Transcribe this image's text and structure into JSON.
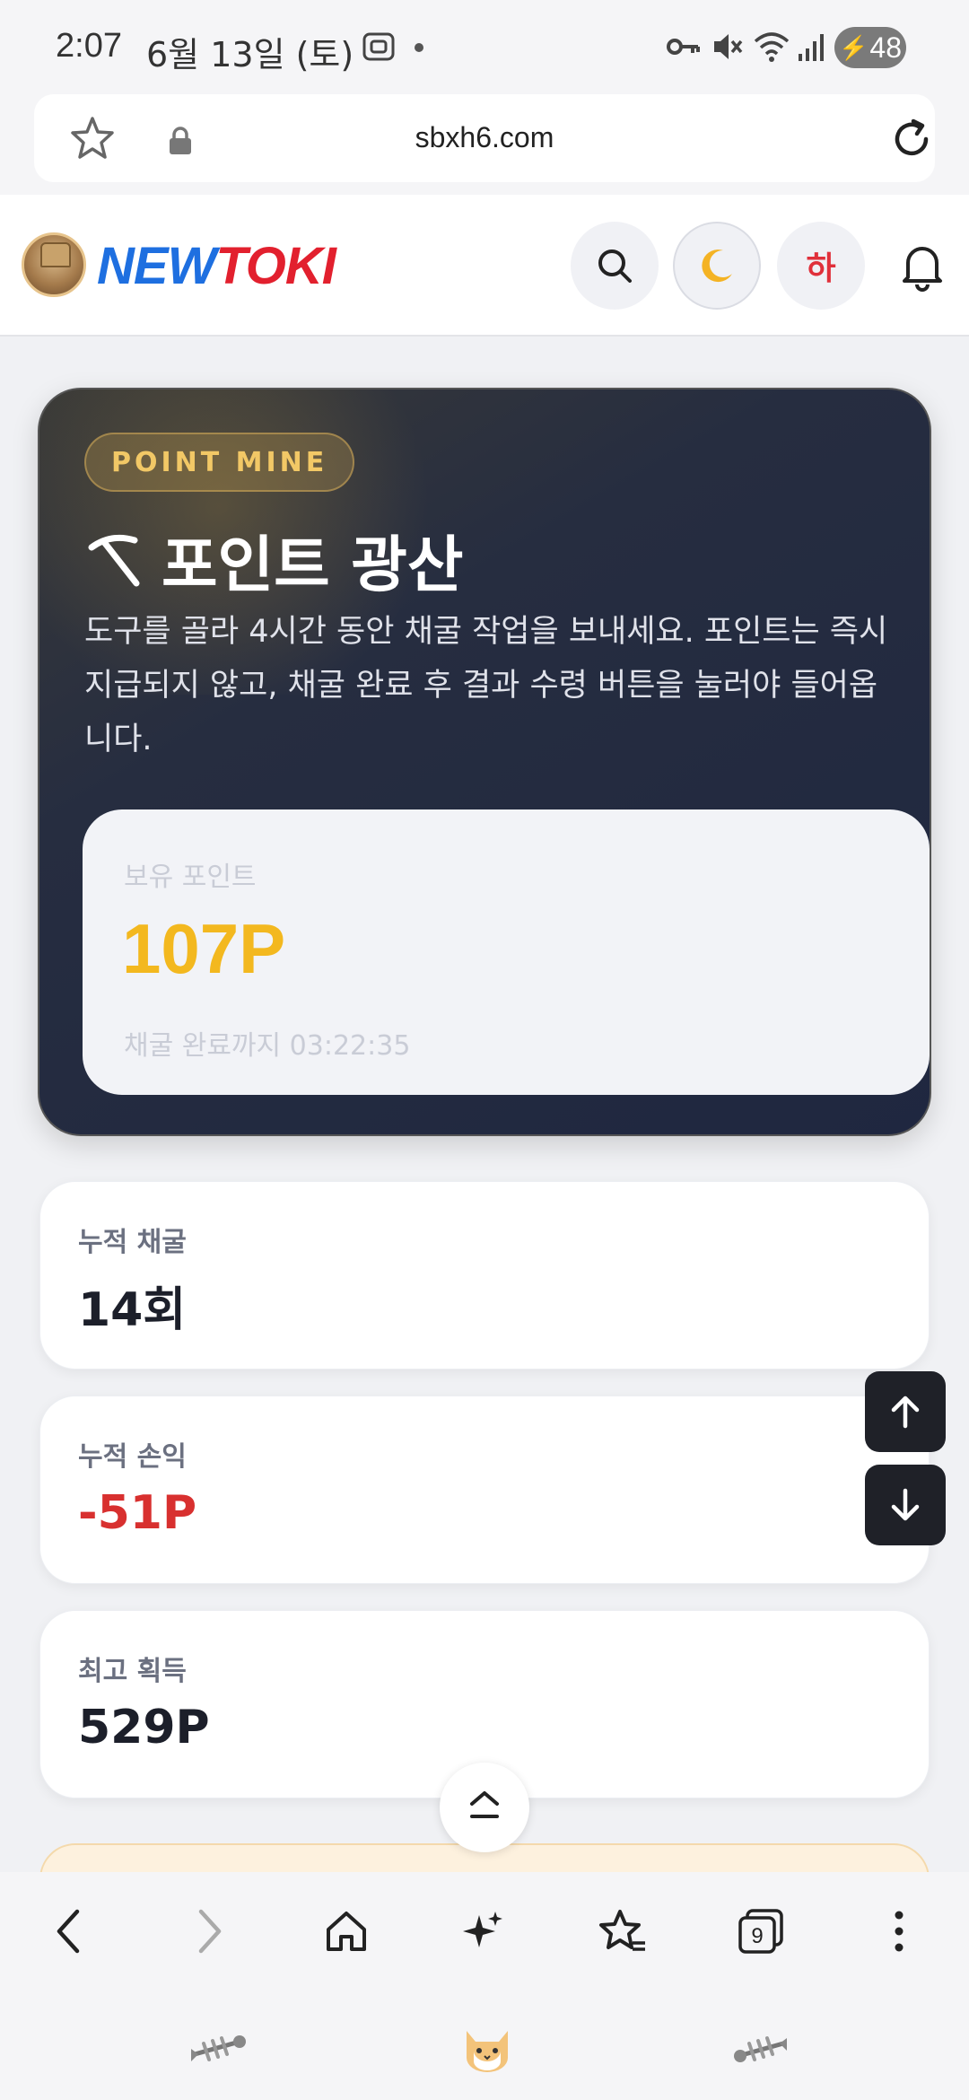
{
  "status_bar": {
    "time": "2:07",
    "date": "6월 13일 (토)",
    "battery": "48",
    "icons": [
      "screenshot-icon",
      "key-icon",
      "mute-icon",
      "wifi-icon",
      "signal-icon",
      "battery-icon"
    ]
  },
  "browser": {
    "url": "sbxh6.com",
    "icons": [
      "star-icon",
      "lock-icon",
      "reload-icon"
    ]
  },
  "header": {
    "logo_part1": "NEW",
    "logo_part2": "TOKI",
    "lang_label": "하",
    "icons": [
      "search-icon",
      "moon-icon",
      "bell-icon"
    ]
  },
  "hero": {
    "badge": "POINT MINE",
    "title": "포인트 광산",
    "description": "도구를 골라 4시간 동안 채굴 작업을 보내세요. 포인트는 즉시 지급되지 않고, 채굴 완료 후 결과 수령 버튼을 눌러야 들어옵니다.",
    "points_label": "보유 포인트",
    "points_value": "107P",
    "timer_text": "채굴 완료까지 03:22:35"
  },
  "stats": [
    {
      "label": "누적 채굴",
      "value": "14회"
    },
    {
      "label": "누적 손익",
      "value": "-51P"
    },
    {
      "label": "최고 획득",
      "value": "529P"
    }
  ],
  "colors": {
    "accent_gold": "#f3b81f",
    "negative": "#d8302f",
    "logo_blue": "#1e6fe0",
    "logo_red": "#e2202e"
  },
  "bottom_nav": {
    "tab_count": "9",
    "icons": [
      "back-icon",
      "forward-icon",
      "home-icon",
      "sparkle-icon",
      "bookmarks-icon",
      "tabs-icon",
      "more-icon"
    ]
  }
}
